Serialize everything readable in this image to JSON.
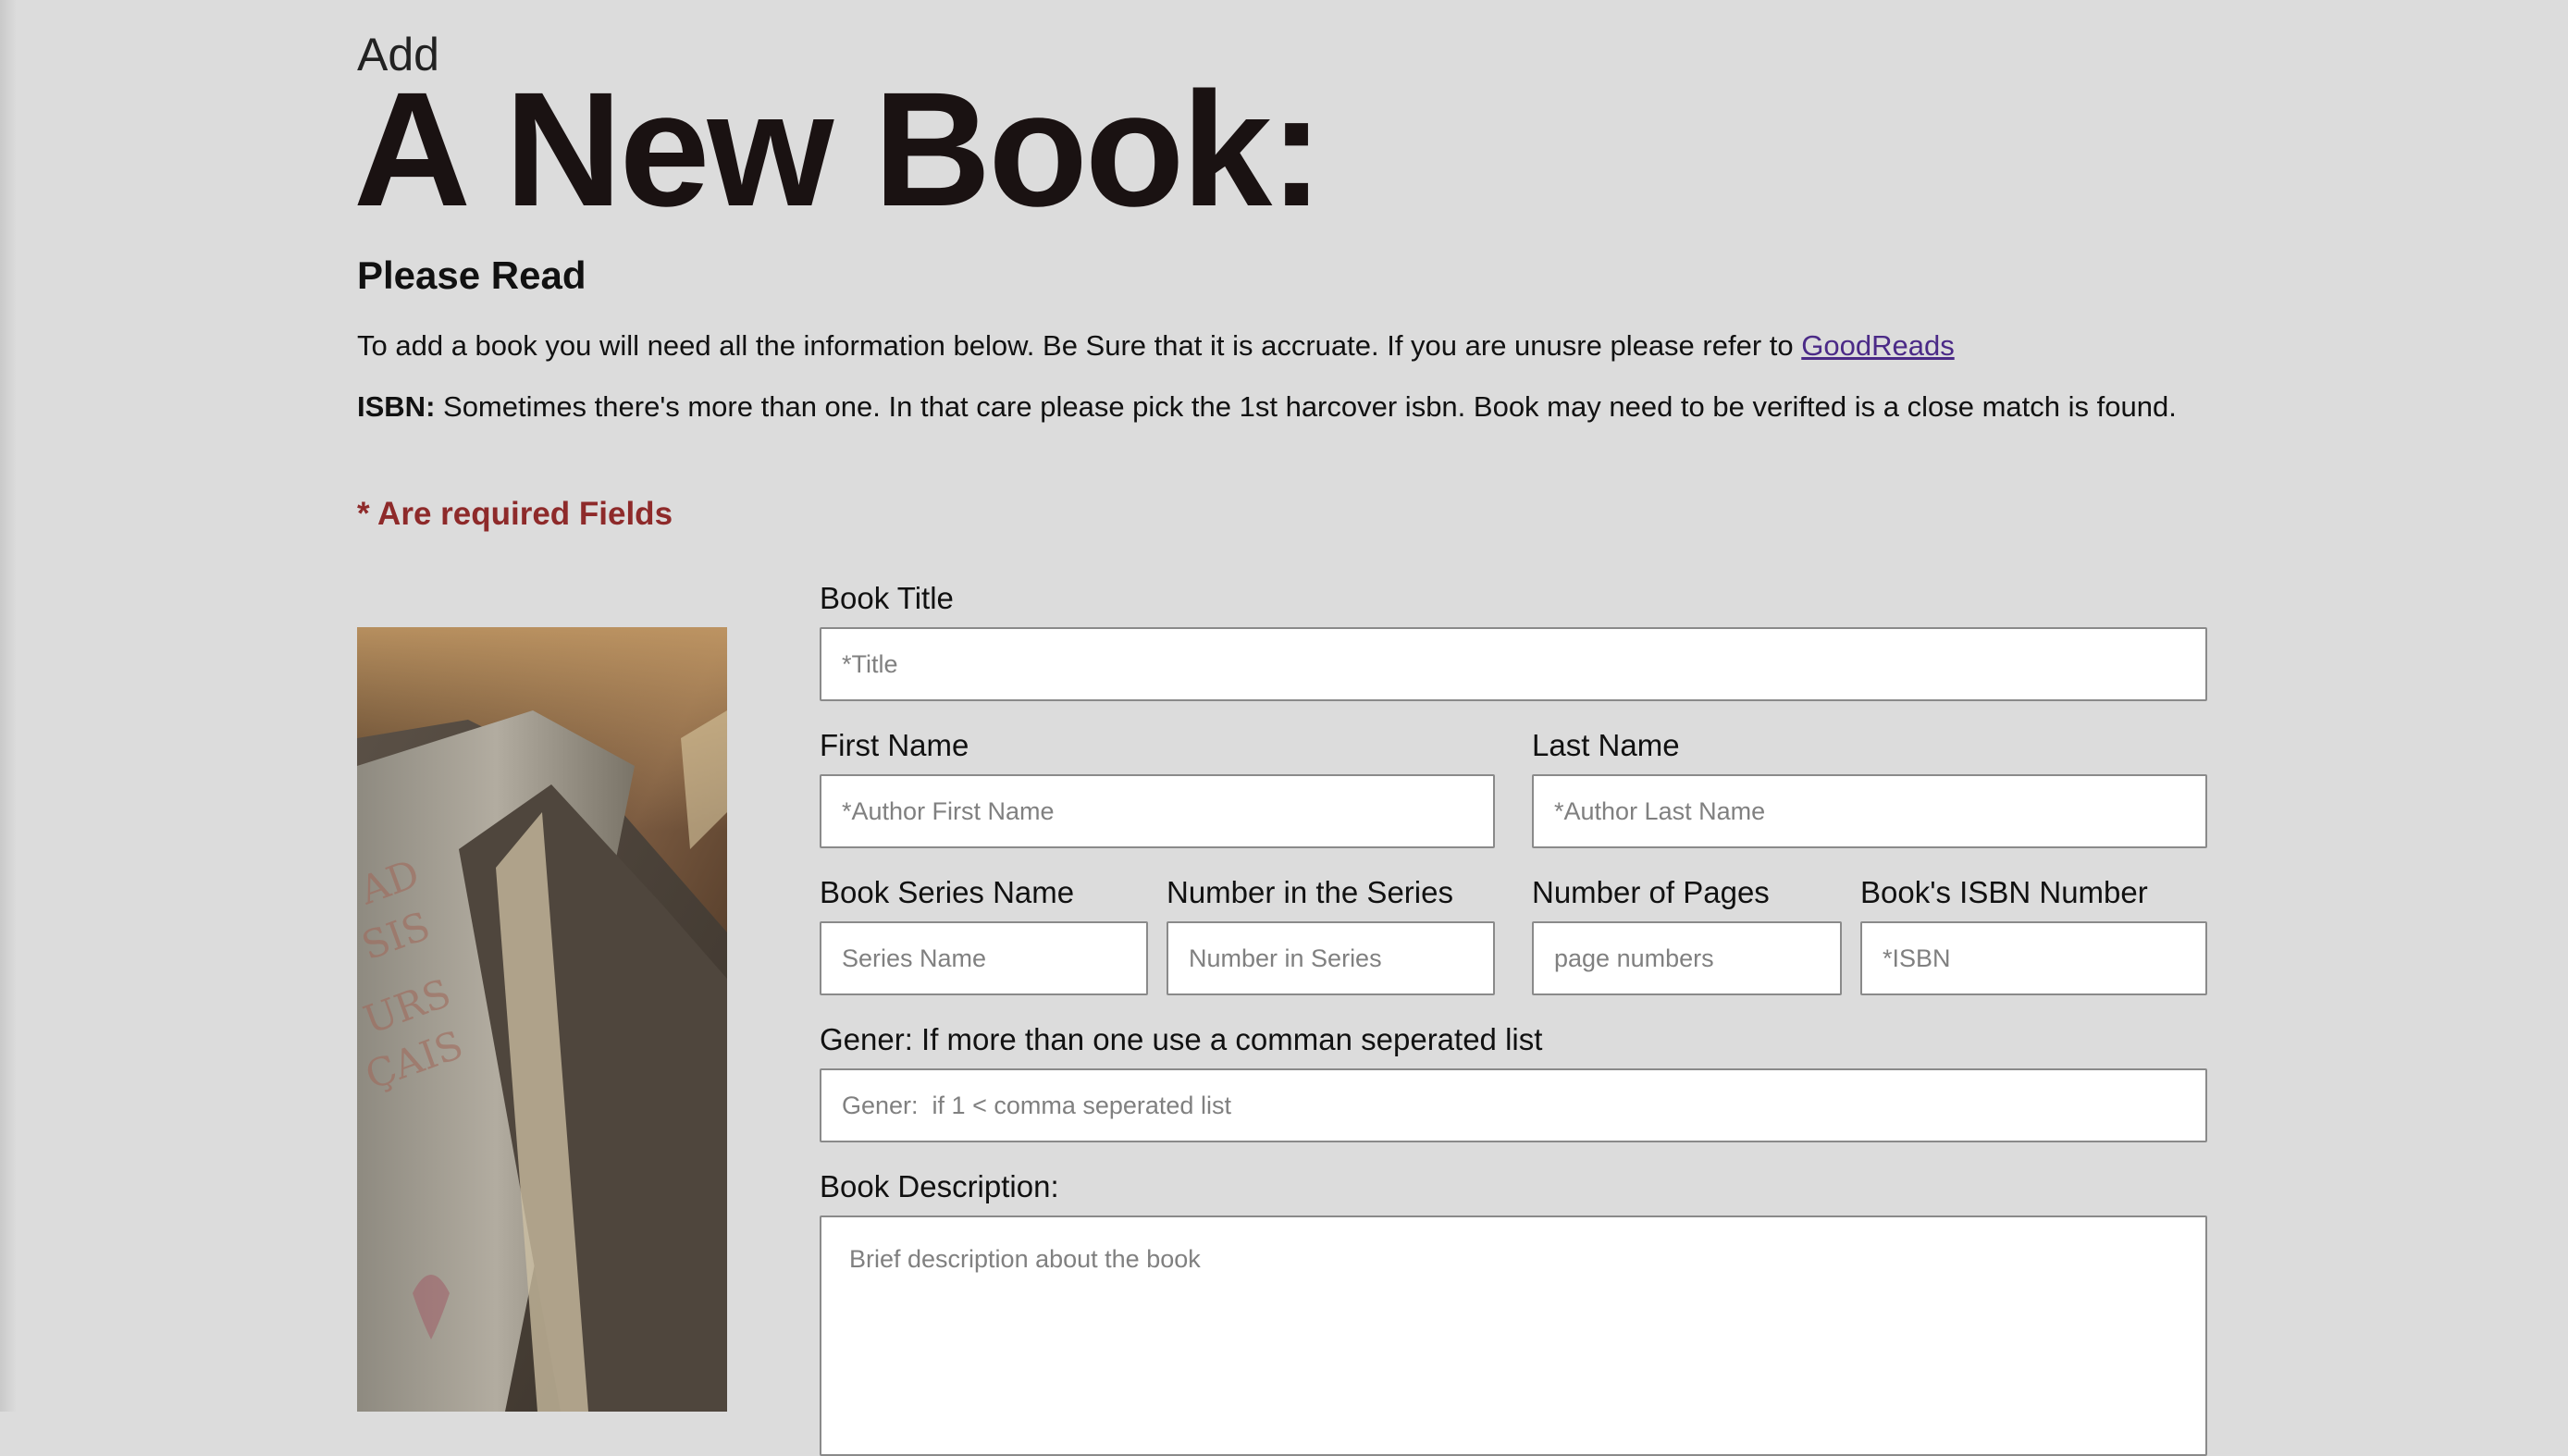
{
  "header": {
    "add": "Add",
    "title": "A New Book:"
  },
  "intro": {
    "heading": "Please Read",
    "line1_text": "To add a book you will need all the information below. Be Sure that it is accruate. If you are unusre please refer to",
    "line1_link": "GoodReads",
    "line2_label": "ISBN:",
    "line2_text": "Sometimes there's more than one. In that care please pick the 1st harcover isbn. Book may need to be verifted is a close match is found.",
    "required_note": "* Are required Fields"
  },
  "form": {
    "book_title": {
      "label": "Book Title",
      "placeholder": "*Title"
    },
    "first_name": {
      "label": "First Name",
      "placeholder": "*Author First Name"
    },
    "last_name": {
      "label": "Last Name",
      "placeholder": "*Author Last Name"
    },
    "series_name": {
      "label": "Book Series Name",
      "placeholder": "Series Name"
    },
    "series_number": {
      "label": "Number in the Series",
      "placeholder": "Number in Series"
    },
    "pages": {
      "label": "Number of Pages",
      "placeholder": "page numbers"
    },
    "isbn": {
      "label": "Book's ISBN Number",
      "placeholder": "*ISBN"
    },
    "genre": {
      "label": "Gener: If more than one use a comman seperated list",
      "placeholder": "Gener:  if 1 < comma seperated list"
    },
    "description": {
      "label": "Book Description:",
      "placeholder": "Brief description about the book"
    }
  },
  "colors": {
    "background": "#dcdcdc",
    "title": "#1a1212",
    "required": "#8e2a2a",
    "link": "#4b2a87"
  }
}
